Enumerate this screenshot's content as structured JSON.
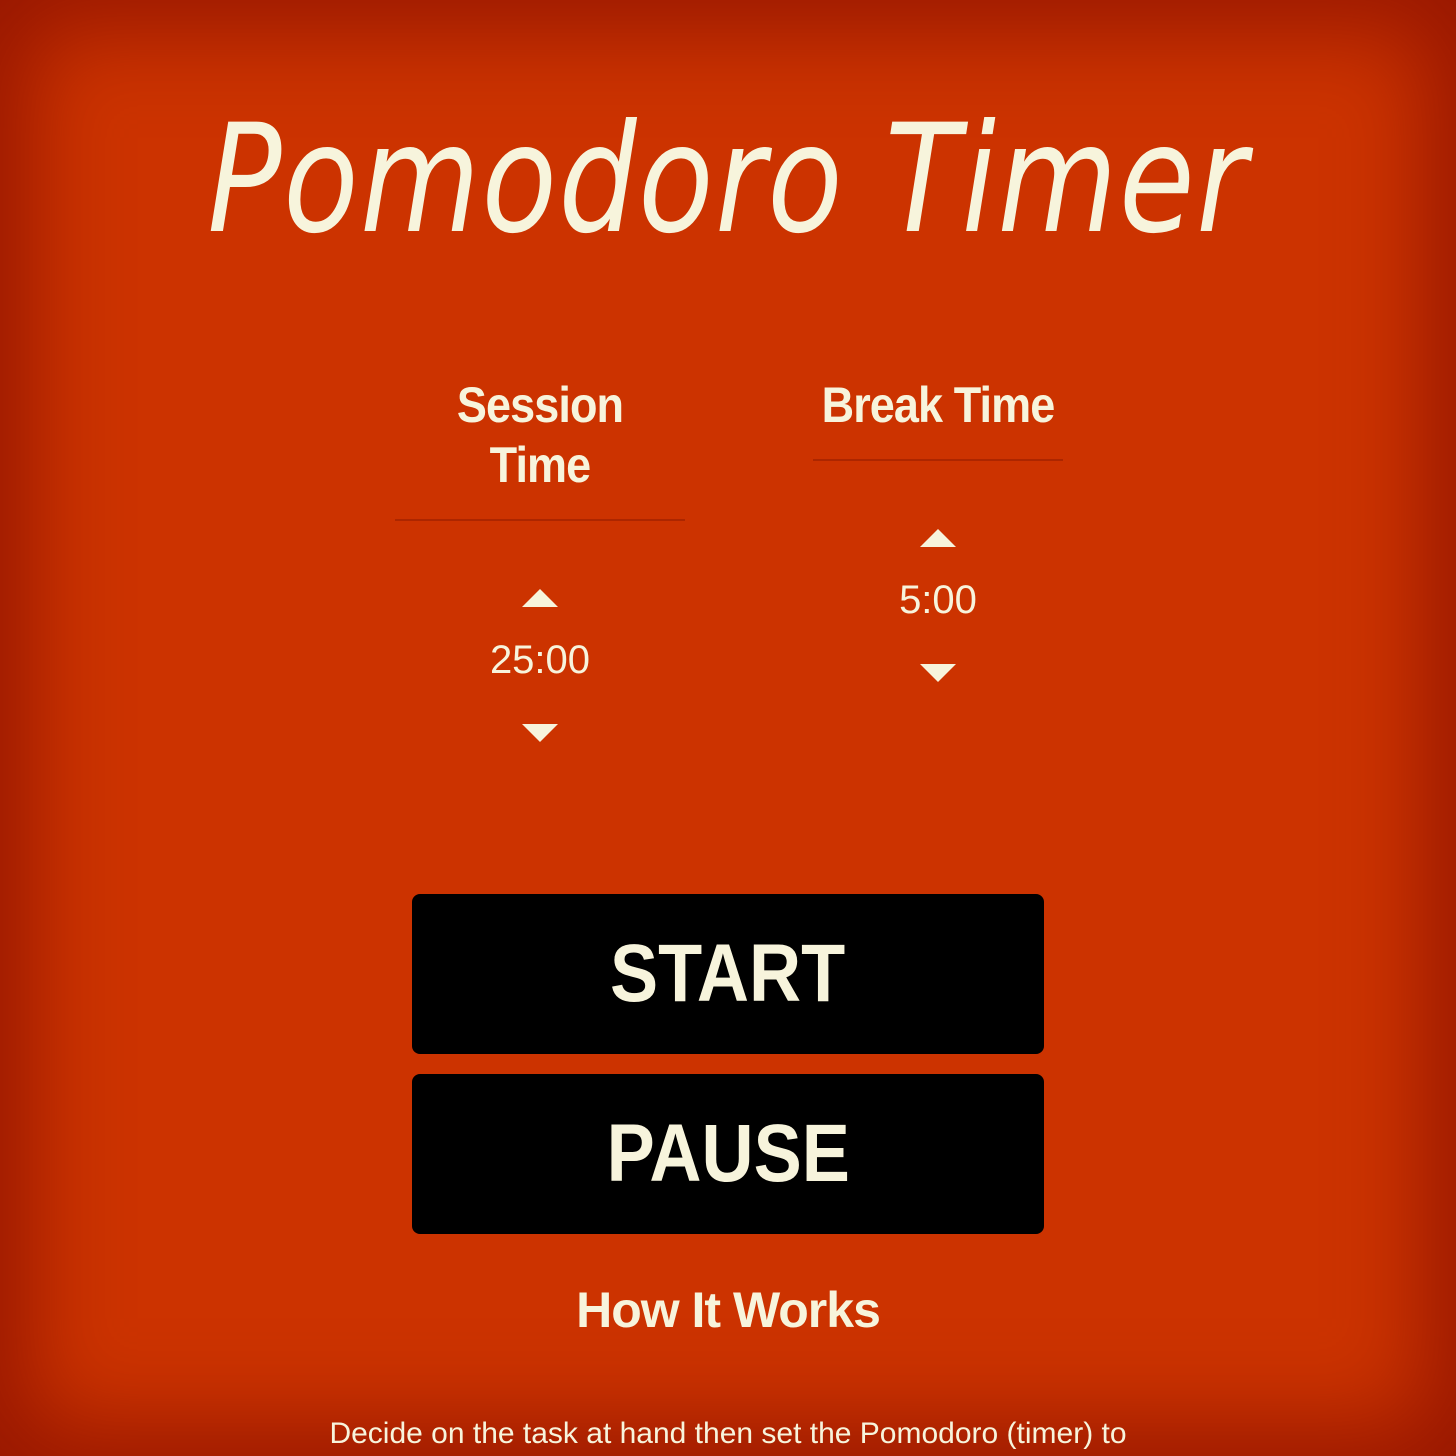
{
  "header": {
    "title": "Pomodoro Timer"
  },
  "settings": {
    "session": {
      "label": "Session Time",
      "value": "25:00",
      "increase_icon": "triangle-up-icon",
      "decrease_icon": "triangle-down-icon"
    },
    "break": {
      "label": "Break Time",
      "value": "5:00",
      "increase_icon": "triangle-up-icon",
      "decrease_icon": "triangle-down-icon"
    }
  },
  "controls": {
    "start_label": "START",
    "pause_label": "PAUSE"
  },
  "how_it_works": {
    "title": "How It Works",
    "text": "Decide on the task at hand then set the Pomodoro (timer) to"
  },
  "colors": {
    "background": "#cc3300",
    "text": "#f7f4dc",
    "button": "#000000"
  }
}
